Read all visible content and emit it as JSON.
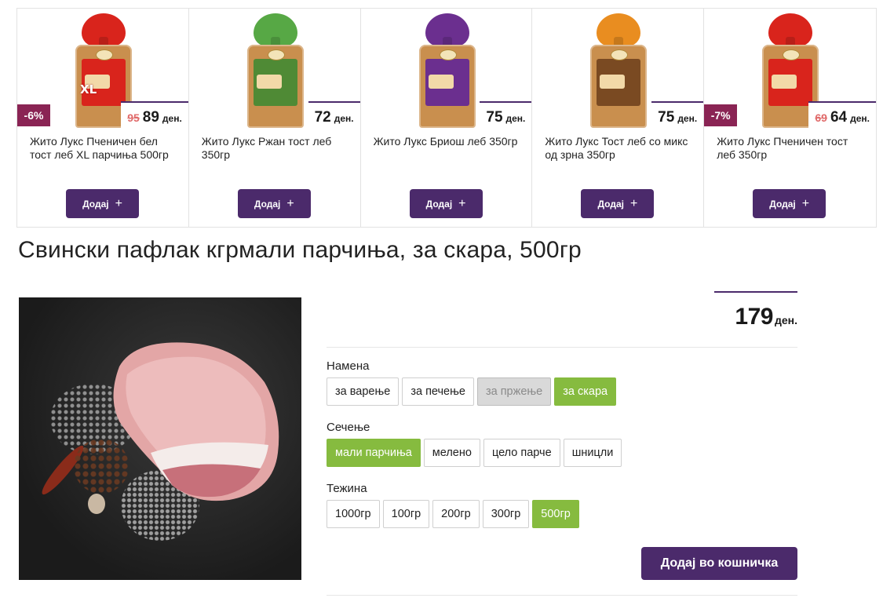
{
  "carousel": {
    "products": [
      {
        "name": "Жито Лукс Пченичен бел тост леб XL парчиња 500гр",
        "discount": "-6%",
        "old_price": "95",
        "price": "89",
        "currency": "ден.",
        "add_label": "Додај",
        "add_icon": "+",
        "bag_color": "#d9241c",
        "label_color": "#d9241c",
        "bag_text": "XL"
      },
      {
        "name": "Жито Лукс Ржан тост леб 350гр",
        "discount": "",
        "old_price": "",
        "price": "72",
        "currency": "ден.",
        "add_label": "Додај",
        "add_icon": "+",
        "bag_color": "#57a845",
        "label_color": "#4f8a35",
        "bag_text": ""
      },
      {
        "name": "Жито Лукс Бриош леб 350гр",
        "discount": "",
        "old_price": "",
        "price": "75",
        "currency": "ден.",
        "add_label": "Додај",
        "add_icon": "+",
        "bag_color": "#6b2f8f",
        "label_color": "#6b2f8f",
        "bag_text": ""
      },
      {
        "name": "Жито Лукс Тост леб со микс од зрна 350гр",
        "discount": "",
        "old_price": "",
        "price": "75",
        "currency": "ден.",
        "add_label": "Додај",
        "add_icon": "+",
        "bag_color": "#e98d20",
        "label_color": "#7a4a22",
        "bag_text": ""
      },
      {
        "name": "Жито Лукс Пченичен тост леб 350гр",
        "discount": "-7%",
        "old_price": "69",
        "price": "64",
        "currency": "ден.",
        "add_label": "Додај",
        "add_icon": "+",
        "bag_color": "#d9241c",
        "label_color": "#d9241c",
        "bag_text": ""
      }
    ]
  },
  "product": {
    "title": "Свински пафлак кгрмали парчиња, за скара, 500гр",
    "price": "179",
    "currency": "ден.",
    "options": [
      {
        "label": "Намена",
        "values": [
          {
            "text": "за варење",
            "state": "normal"
          },
          {
            "text": "за печење",
            "state": "normal"
          },
          {
            "text": "за пржење",
            "state": "disabled"
          },
          {
            "text": "за скара",
            "state": "selected"
          }
        ]
      },
      {
        "label": "Сечење",
        "values": [
          {
            "text": "мали парчиња",
            "state": "selected"
          },
          {
            "text": "мелено",
            "state": "normal"
          },
          {
            "text": "цело парче",
            "state": "normal"
          },
          {
            "text": "шницли",
            "state": "normal"
          }
        ]
      },
      {
        "label": "Тежина",
        "values": [
          {
            "text": "1000гр",
            "state": "normal"
          },
          {
            "text": "100гр",
            "state": "normal"
          },
          {
            "text": "200гр",
            "state": "normal"
          },
          {
            "text": "300гр",
            "state": "normal"
          },
          {
            "text": "500гр",
            "state": "selected"
          }
        ]
      }
    ],
    "add_to_cart_label": "Додај во кошничка"
  },
  "colors": {
    "accent": "#4b2a6b",
    "selected": "#86bb3f",
    "discount": "#8a2454",
    "old_price": "#e06a6a"
  }
}
